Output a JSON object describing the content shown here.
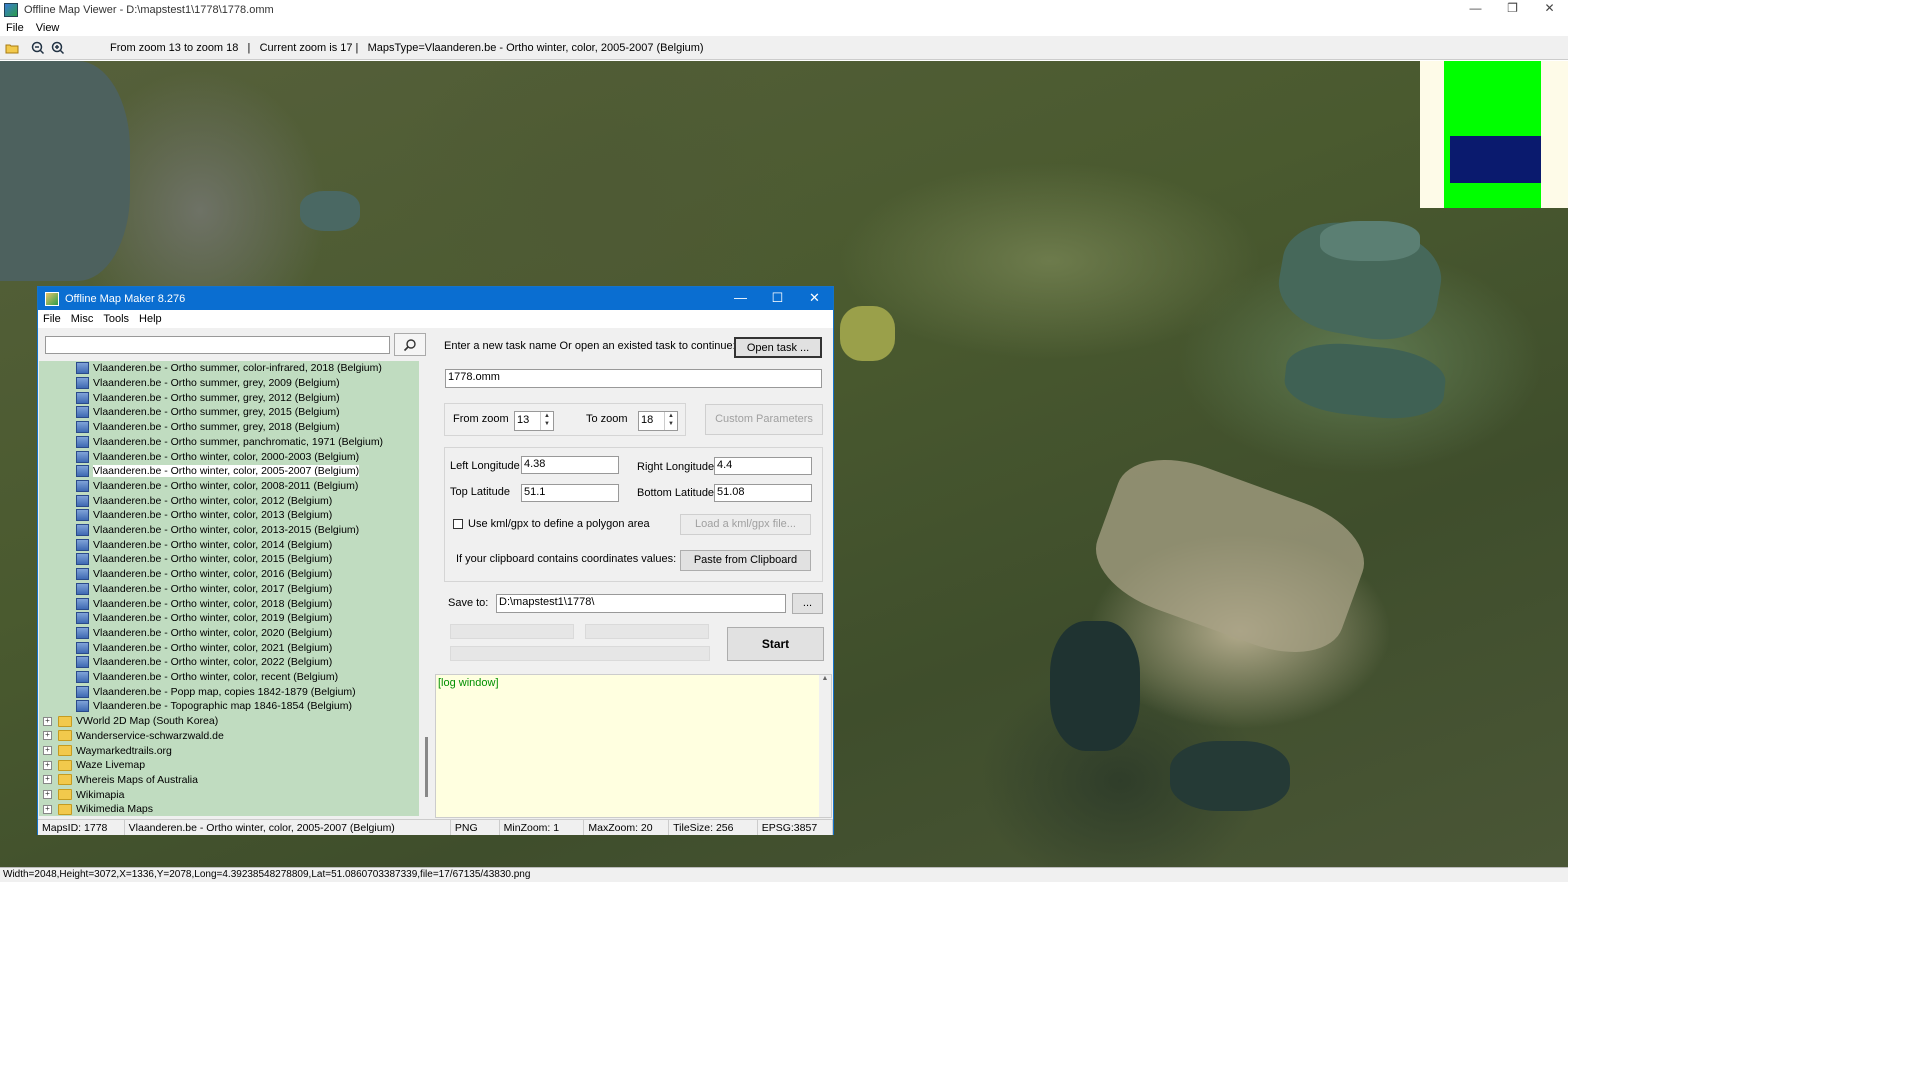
{
  "window": {
    "title": "Offline Map Viewer - D:\\mapstest1\\1778\\1778.omm",
    "menu": [
      "File",
      "View"
    ],
    "controls": {
      "minimize": "—",
      "restore": "❐",
      "close": "✕"
    }
  },
  "toolbar": {
    "info": "From zoom 13 to zoom 18   |   Current zoom is 17 |   MapsType=Vlaanderen.be - Ortho winter, color, 2005-2007 (Belgium)",
    "icons": [
      "open-folder-icon",
      "zoom-out-icon",
      "zoom-in-icon"
    ]
  },
  "status_bottom": "Width=2048,Height=3072,X=1336,Y=2078,Long=4.39238548278809,Lat=51.0860703387339,file=17/67135/43830.png",
  "minimap": {
    "colors": {
      "background": "#fefbe8",
      "area": "#00ff00",
      "view": "#0a1a6e"
    }
  },
  "dialog": {
    "title": "Offline Map Maker 8.276",
    "controls": {
      "minimize": "—",
      "maximize": "☐",
      "close": "✕"
    },
    "menu": [
      "File",
      "Misc",
      "Tools",
      "Help"
    ],
    "search": {
      "value": "",
      "icon": "search-icon"
    },
    "tree": {
      "leaves": [
        "Vlaanderen.be - Ortho summer, color-infrared, 2018 (Belgium)",
        "Vlaanderen.be - Ortho summer, grey, 2009 (Belgium)",
        "Vlaanderen.be - Ortho summer, grey, 2012 (Belgium)",
        "Vlaanderen.be - Ortho summer, grey, 2015 (Belgium)",
        "Vlaanderen.be - Ortho summer, grey, 2018 (Belgium)",
        "Vlaanderen.be - Ortho summer, panchromatic, 1971 (Belgium)",
        "Vlaanderen.be - Ortho winter, color, 2000-2003 (Belgium)",
        "Vlaanderen.be - Ortho winter, color, 2005-2007 (Belgium)",
        "Vlaanderen.be - Ortho winter, color, 2008-2011 (Belgium)",
        "Vlaanderen.be - Ortho winter, color, 2012 (Belgium)",
        "Vlaanderen.be - Ortho winter, color, 2013 (Belgium)",
        "Vlaanderen.be - Ortho winter, color, 2013-2015 (Belgium)",
        "Vlaanderen.be - Ortho winter, color, 2014 (Belgium)",
        "Vlaanderen.be - Ortho winter, color, 2015 (Belgium)",
        "Vlaanderen.be - Ortho winter, color, 2016 (Belgium)",
        "Vlaanderen.be - Ortho winter, color, 2017 (Belgium)",
        "Vlaanderen.be - Ortho winter, color, 2018 (Belgium)",
        "Vlaanderen.be - Ortho winter, color, 2019 (Belgium)",
        "Vlaanderen.be - Ortho winter, color, 2020 (Belgium)",
        "Vlaanderen.be - Ortho winter, color, 2021 (Belgium)",
        "Vlaanderen.be - Ortho winter, color, 2022 (Belgium)",
        "Vlaanderen.be - Ortho winter, color, recent (Belgium)",
        "Vlaanderen.be - Popp map, copies 1842-1879 (Belgium)",
        "Vlaanderen.be - Topographic map 1846-1854 (Belgium)"
      ],
      "selected_leaf": 7,
      "folders": [
        "VWorld 2D Map (South Korea)",
        "Wanderservice-schwarzwald.de",
        "Waymarkedtrails.org",
        "Waze Livemap",
        "Whereis Maps of Australia",
        "Wikimapia",
        "Wikimedia Maps"
      ],
      "expander": "+"
    },
    "task": {
      "prompt": "Enter a new task name Or open an existed task to continue:",
      "open_button": "Open task ...",
      "name_value": "1778.omm"
    },
    "zoom": {
      "from_label": "From zoom",
      "from_value": "13",
      "to_label": "To zoom",
      "to_value": "18",
      "custom_button": "Custom Parameters"
    },
    "coords": {
      "left_label": "Left Longitude",
      "left_value": "4.38",
      "right_label": "Right Longitude",
      "right_value": "4.4",
      "top_label": "Top Latitude",
      "top_value": "51.1",
      "bottom_label": "Bottom Latitude",
      "bottom_value": "51.08",
      "kml_checkbox_label": "Use kml/gpx to define a polygon area",
      "kml_checked": false,
      "kml_button": "Load a kml/gpx file...",
      "clipboard_label": "If your clipboard contains coordinates values:",
      "clipboard_button": "Paste from Clipboard"
    },
    "save": {
      "label": "Save to:",
      "value": "D:\\mapstest1\\1778\\",
      "browse_button": "...",
      "start_button": "Start"
    },
    "log": {
      "text": "[log window]"
    },
    "status": [
      "MapsID: 1778",
      "Vlaanderen.be - Ortho winter, color, 2005-2007 (Belgium)",
      "PNG",
      "MinZoom: 1",
      "MaxZoom: 20",
      "TileSize: 256",
      "EPSG:3857"
    ]
  }
}
